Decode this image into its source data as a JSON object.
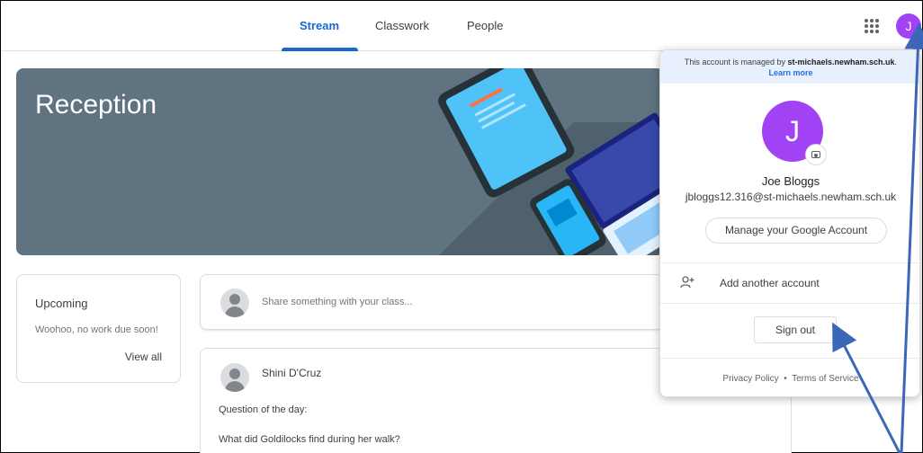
{
  "tabs": [
    {
      "label": "Stream",
      "active": true
    },
    {
      "label": "Classwork",
      "active": false
    },
    {
      "label": "People",
      "active": false
    }
  ],
  "header": {
    "avatar_initial": "J"
  },
  "banner": {
    "title": "Reception",
    "color": "#5f7380"
  },
  "upcoming": {
    "title": "Upcoming",
    "text": "Woohoo, no work due soon!",
    "link": "View all"
  },
  "share": {
    "placeholder": "Share something with your class..."
  },
  "post": {
    "author": "Shini D'Cruz",
    "line1": "Question of the day:",
    "line2": "What did Goldilocks find during her walk?"
  },
  "account_popup": {
    "managed_prefix": "This account is managed by",
    "managed_domain": "st-michaels.newham.sch.uk",
    "managed_suffix": ".",
    "learn_more": "Learn more",
    "avatar_initial": "J",
    "name": "Joe Bloggs",
    "email": "jbloggs12.316@st-michaels.newham.sch.uk",
    "manage_button": "Manage your Google Account",
    "add_account": "Add another account",
    "sign_out": "Sign out",
    "privacy": "Privacy Policy",
    "separator": "•",
    "terms": "Terms of Service"
  },
  "colors": {
    "accent": "#1967d2",
    "avatar": "#a142f4",
    "annotation_arrow": "#3c66b8"
  },
  "icons": [
    "apps-grid-icon",
    "camera-icon",
    "add-person-icon",
    "default-avatar-icon"
  ]
}
